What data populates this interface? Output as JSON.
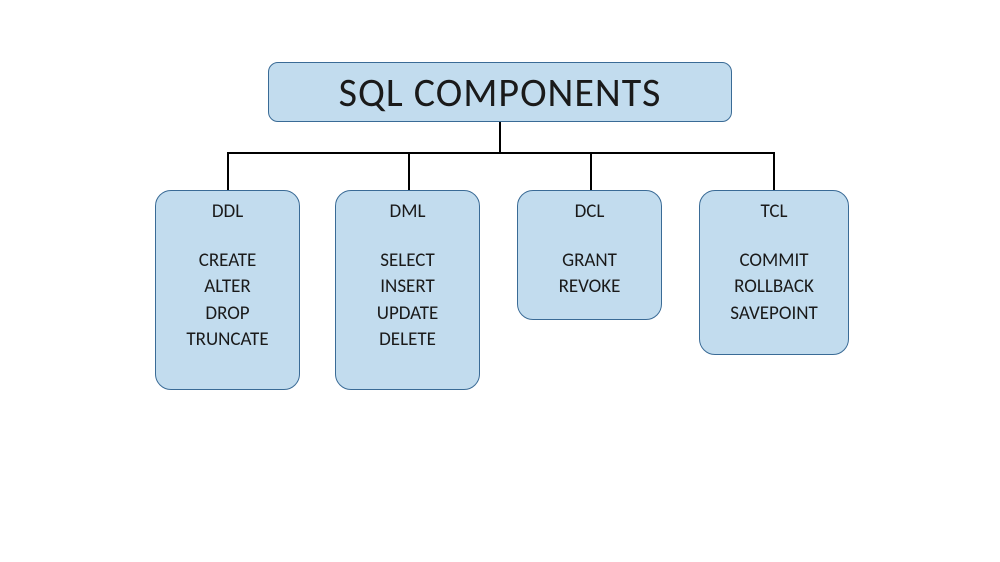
{
  "title": "SQL COMPONENTS",
  "children": [
    {
      "name": "DDL",
      "items": [
        "CREATE",
        "ALTER",
        "DROP",
        "TRUNCATE"
      ]
    },
    {
      "name": "DML",
      "items": [
        "SELECT",
        "INSERT",
        "UPDATE",
        "DELETE"
      ]
    },
    {
      "name": "DCL",
      "items": [
        "GRANT",
        "REVOKE"
      ]
    },
    {
      "name": "TCL",
      "items": [
        "COMMIT",
        "ROLLBACK",
        "SAVEPOINT"
      ]
    }
  ]
}
